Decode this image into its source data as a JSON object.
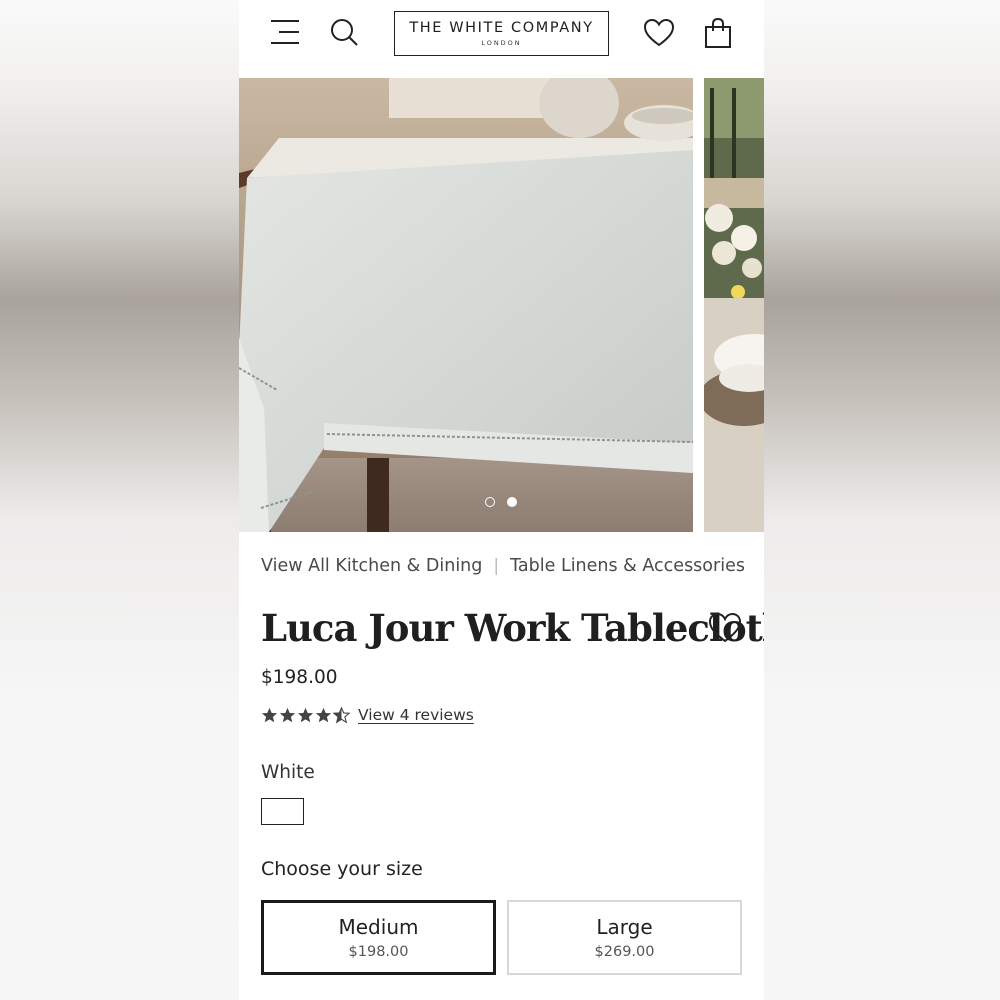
{
  "header": {
    "brand": "THE WHITE COMPANY",
    "brand_sub": "LONDON",
    "icons": [
      "menu-icon",
      "search-icon",
      "heart-icon",
      "shopping-bag-icon"
    ]
  },
  "gallery": {
    "slide_count": 2,
    "active_index": 0
  },
  "breadcrumb": {
    "items": [
      "View All Kitchen & Dining",
      "Table Linens & Accessories"
    ],
    "separator": "|"
  },
  "product": {
    "title": "Luca Jour Work Tablecloth",
    "price": "$198.00",
    "rating": 4.5,
    "rating_max": 5,
    "reviews_link": "View 4 reviews",
    "colour_label": "White",
    "colour_swatch": "#ffffff",
    "size_heading": "Choose your size",
    "sizes": [
      {
        "name": "Medium",
        "price": "$198.00",
        "selected": true
      },
      {
        "name": "Large",
        "price": "$269.00",
        "selected": false
      }
    ]
  },
  "colors": {
    "text": "#1f1f1f",
    "border_selected": "#1a1a1a",
    "border_unselected": "#d8d8d8"
  }
}
